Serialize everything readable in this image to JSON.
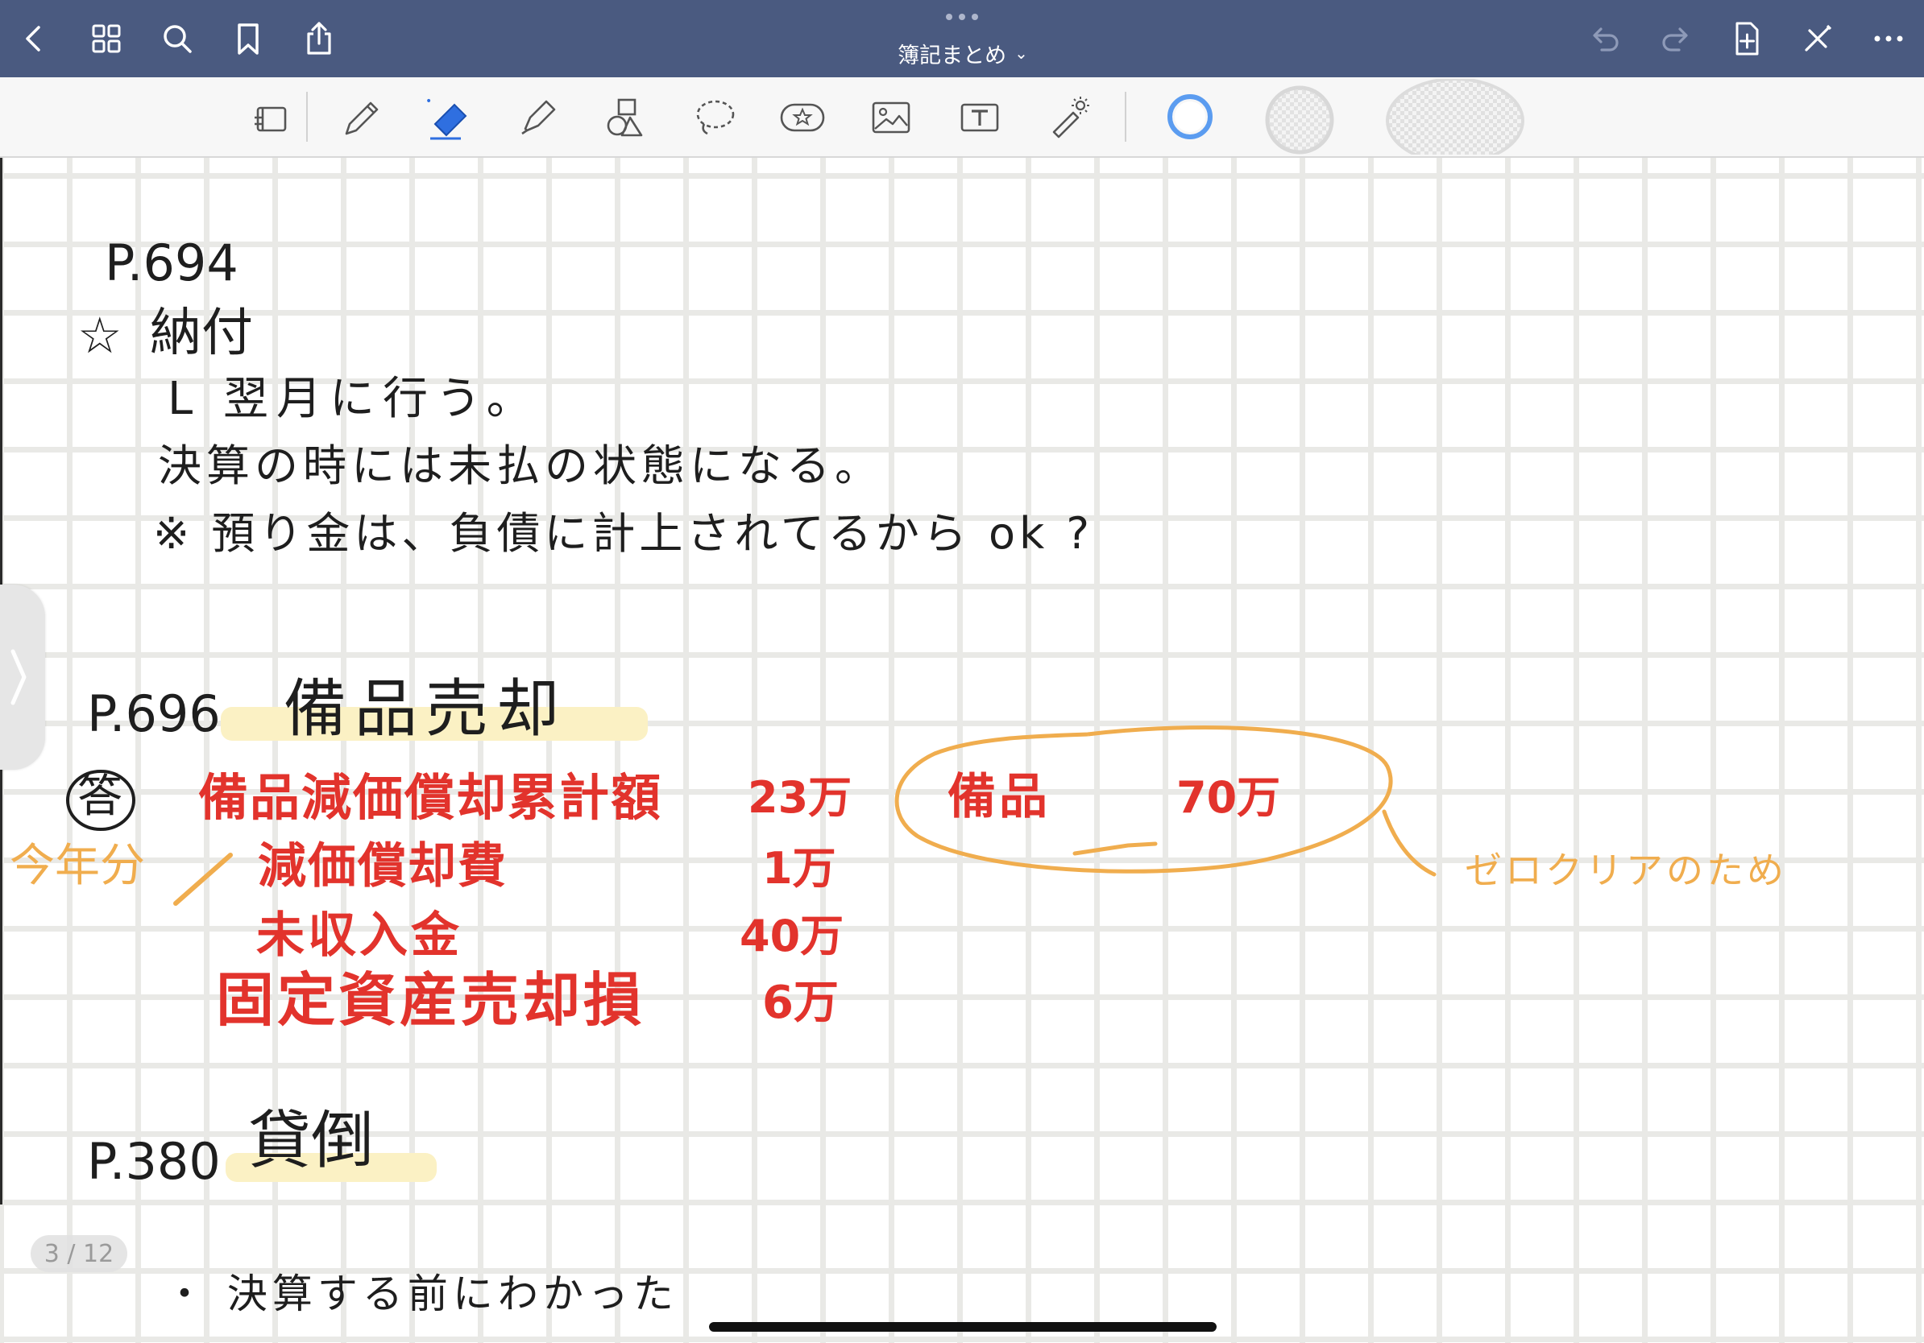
{
  "header": {
    "title": "簿記まとめ",
    "icons": [
      "back-icon",
      "grid-icon",
      "search-icon",
      "bookmark-icon",
      "share-icon",
      "undo-icon",
      "redo-icon",
      "add-page-icon",
      "close-pen-icon",
      "more-icon"
    ]
  },
  "toolbar": {
    "tools": [
      "read-mode-icon",
      "pen-icon",
      "eraser-icon",
      "highlighter-icon",
      "shapes-icon",
      "lasso-icon",
      "sticker-icon",
      "image-icon",
      "text-icon",
      "laser-pointer-icon"
    ],
    "colors": {
      "selected_ring": "#5b9cf0",
      "eraser": "#2f6fe0"
    }
  },
  "note": {
    "page_counter": "3 / 12",
    "section1": {
      "page_ref": "P.694",
      "heading_mark": "☆",
      "heading": "納付",
      "lines": [
        "L 翌月に行う。",
        "決算の時には未払の状態になる。",
        "※ 預り金は、負債に計上されてるから ok ?"
      ]
    },
    "section2": {
      "page_ref": "P.696",
      "heading": "備品売却",
      "answer_mark": "答",
      "entries": [
        {
          "account": "備品減価償却累計額",
          "amount": "23万"
        },
        {
          "account": "減価償却費",
          "amount": "1万"
        },
        {
          "account": "未収入金",
          "amount": "40万"
        },
        {
          "account": "固定資産売却損",
          "amount": "6万"
        }
      ],
      "credit": {
        "account": "備品",
        "amount": "70万"
      },
      "annotation_left": "今年分",
      "annotation_right": "ゼロクリアのため"
    },
    "section3": {
      "page_ref": "P.380",
      "heading": "貸倒",
      "lines": [
        "・ 決算する前にわかった"
      ]
    },
    "ink_colors": {
      "black": "#1e1e1e",
      "red": "#e2332c",
      "orange": "#f0ad4e",
      "highlight": "#fbf1c4"
    }
  }
}
